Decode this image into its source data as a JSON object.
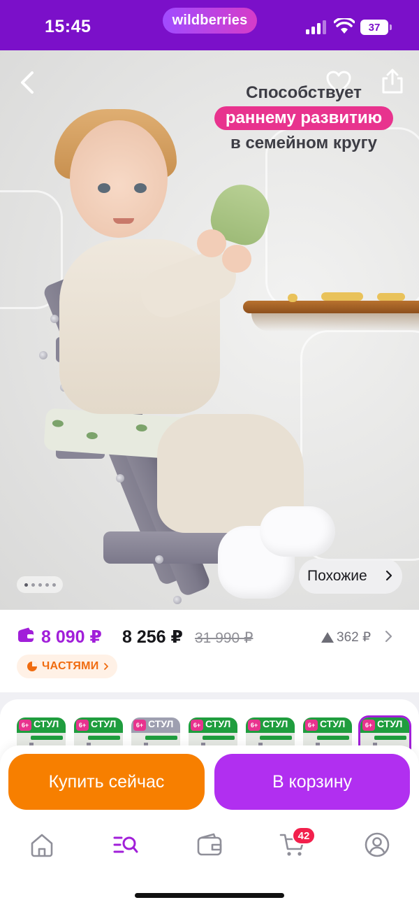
{
  "status_bar": {
    "time": "15:45",
    "brand": "wildberries",
    "battery": "37"
  },
  "hero": {
    "promo": {
      "line1": "Способствует",
      "highlight": "раннему развитию",
      "line2": "в семейном кругу"
    },
    "similar_label": "Похожие",
    "dots_count": 5,
    "active_dot": 0
  },
  "price": {
    "wallet_price": "8 090 ₽",
    "regular_price": "8 256 ₽",
    "old_price": "31 990 ₽",
    "history_delta": "362 ₽",
    "installments_label": "ЧАСТЯМИ"
  },
  "variants": [
    {
      "word": "СТУЛ",
      "age": "6+",
      "style": "green"
    },
    {
      "word": "СТУЛ",
      "age": "6+",
      "style": "green"
    },
    {
      "word": "СТУЛ",
      "age": "6+",
      "style": "gray"
    },
    {
      "word": "СТУЛ",
      "age": "6+",
      "style": "green"
    },
    {
      "word": "СТУЛ",
      "age": "6+",
      "style": "green"
    },
    {
      "word": "СТУЛ",
      "age": "6+",
      "style": "green"
    },
    {
      "word": "СТУЛ",
      "age": "6+",
      "style": "green",
      "selected": true
    }
  ],
  "actions": {
    "buy_now": "Купить сейчас",
    "add_to_cart": "В корзину"
  },
  "tab_bar": {
    "items": [
      {
        "name": "home-icon"
      },
      {
        "name": "catalog-search-icon",
        "active": true
      },
      {
        "name": "wallet-icon"
      },
      {
        "name": "cart-icon"
      },
      {
        "name": "profile-icon"
      }
    ],
    "cart_badge": "42"
  },
  "colors": {
    "brand": "#7b10c9",
    "accent_purple": "#a11fd9",
    "buy_button": "#f77f00",
    "cart_button": "#b12ff0",
    "promo_pink": "#e8338e",
    "badge_red": "#f2204c"
  }
}
